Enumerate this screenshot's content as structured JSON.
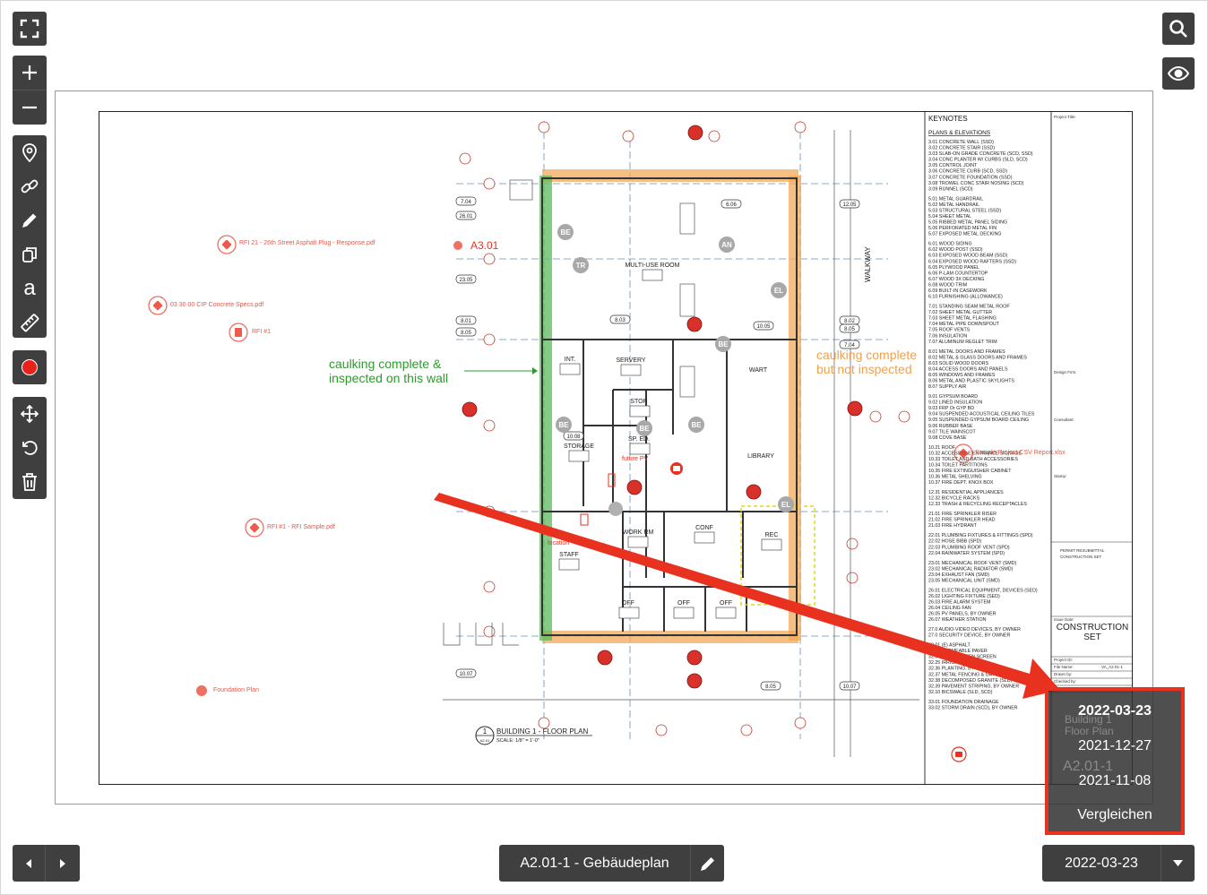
{
  "toolbar": {
    "fullscreen_icon": "fullscreen-icon",
    "zoom_in_icon": "plus-icon",
    "zoom_out_icon": "minus-icon",
    "tools": [
      "pin-icon",
      "link-icon",
      "pen-icon",
      "copy-icon",
      "text-tool",
      "ruler-icon"
    ],
    "text_tool_label": "a",
    "record_color": "#e8211b",
    "edit_tools": [
      "move-icon",
      "undo-icon",
      "trash-icon"
    ]
  },
  "top_right": {
    "search_icon": "search-icon",
    "visibility_icon": "eye-icon"
  },
  "annotations": {
    "green_note": [
      "caulking complete &",
      "inspected on this wall"
    ],
    "orange_note": [
      "caulking complete",
      "but not inspected"
    ],
    "red_label": "A3.01",
    "rfi_21": "RFI 21 - 26th Street Asphalt Plug - Response.pdf",
    "specs": "03 30 00 CIP Concrete Specs.pdf",
    "rfi_1": "RFI #1",
    "rfi_sample": "RFI #1 - RFI Sample.pdf",
    "foundation": "Foundation Plan",
    "csv_report": "Sample Project CSV Report.xlsx",
    "printer": "Printer location",
    "future_pv": "future PV",
    "colors": {
      "green": "#2e9a2e",
      "orange": "#f0a050",
      "red": "#e8321f"
    }
  },
  "drawing": {
    "keynotes_title": "KEYNOTES",
    "plans_elevations": "PLANS & ELEVATIONS",
    "keynote_lines": [
      "3.01 CONCRETE WALL (SSD)",
      "3.02 CONCRETE STAIR (SSD)",
      "3.03 SLAB-ON GRADE CONCRETE (SCD, SSD)",
      "3.04 CONC PLANTER W/ CURBS (SLD, SCD)",
      "3.05 CONTROL JOINT",
      "3.06 CONCRETE CURB (SCD, SSD)",
      "3.07 CONCRETE FOUNDATION (SSD)",
      "3.08 TROWEL CONC STAIR NOSING (SCD)",
      "3.09 RUNNEL (SCD)",
      "",
      "5.01 METAL GUARDRAIL",
      "5.02 METAL HANDRAIL",
      "5.03 STRUCTURAL STEEL (SSD)",
      "5.04 SHEET METAL",
      "5.05 RIBBED METAL PANEL SIDING",
      "5.06 PERFORATED METAL FIN",
      "5.07 EXPOSED METAL DECKING",
      "",
      "6.01 WOOD SIDING",
      "6.02 WOOD POST (SSD)",
      "6.03 EXPOSED WOOD BEAM (SSD)",
      "6.04 EXPOSED WOOD RAFTERS (SSD)",
      "6.05 PLYWOOD PANEL",
      "6.06 P-LAM COUNTERTOP",
      "6.07 WOOD 3X DECKING",
      "6.08 WOOD TRIM",
      "6.09 BUILT-IN CASEWORK",
      "6.10 FURNISHING (ALLOWANCE)",
      "",
      "7.01 STANDING SEAM METAL ROOF",
      "7.02 SHEET METAL GUTTER",
      "7.03 SHEET METAL FLASHING",
      "7.04 METAL PIPE DOWNSPOUT",
      "7.05 ROOF VENTS",
      "7.06 INSULATION",
      "7.07 ALUMINUM REGLET TRIM",
      "",
      "8.01 METAL DOORS AND FRAMES",
      "8.02 METAL & GLASS DOORS AND FRAMES",
      "8.03 SOLID WOOD DOORS",
      "8.04 ACCESS DOORS AND PANELS",
      "8.05 WINDOWS AND FRAMES",
      "8.06 METAL AND PLASTIC SKYLIGHTS",
      "8.07 SUPPLY AIR",
      "",
      "9.01 GYPSUM BOARD",
      "9.02 LINED INSULATION",
      "9.03 FRP Or GYP BD",
      "9.04 SUSPENDED ACOUSTICAL CEILING TILES",
      "9.05 SUSPENDED GYPSUM BOARD CEILING",
      "9.06 RUBBER BASE",
      "9.07 TILE WAINSCOT",
      "9.08 COVE BASE",
      "",
      "10.21 ROOF",
      "10.32 ACCESSIBLE ENTRANCE SIGNAGE",
      "10.33 TOILET AND BATH ACCESSORIES",
      "10.34 TOILET PARTITIONS",
      "10.35 FIRE EXTINGUISHER CABINET",
      "10.36 METAL SHELVING",
      "10.37 FIRE DEPT. KNOX BOX",
      "",
      "12.31 RESIDENTIAL APPLIANCES",
      "12.32 BICYCLE RACKS",
      "12.33 TRASH & RECYCLING RECEPTACLES",
      "",
      "21.01 FIRE SPRINKLER RISER",
      "21.02 FIRE SPRINKLER HEAD",
      "21.03 FIRE HYDRANT",
      "",
      "22.01 PLUMBING FIXTURES & FITTINGS (SPD)",
      "22.02 HOSE BIBB (SPD)",
      "22.03 PLUMBING ROOF VENT (SPD)",
      "22.04 RAINWATER SYSTEM (SPD)",
      "",
      "23.01 MECHANICAL ROOF VENT (SMD)",
      "23.02 MECHANICAL RADIATOR (SMD)",
      "23.04 EXHAUST FAN (SMD)",
      "23.05 MECHANICAL UNIT (SMD)",
      "",
      "26.01 ELECTRICAL EQUIPMENT, DEVICES (SED)",
      "26.02 LIGHTING FIXTURE (SED)",
      "26.03 FIRE ALARM SYSTEM",
      "26.04 CEILING FAN",
      "26.05 PV PANELS, BY OWNER",
      "26.07 WEATHER STATION",
      "",
      "27.0 AUDIO-VIDEO DEVICES, BY OWNER",
      "27.0 SECURITY DEVICE, BY OWNER",
      "",
      "32.01 (E) ASPHALT",
      "32.02 PERMEABLE PAVER",
      "32.04 METAL GREEN SCREEN",
      "32.25 IRRIGATION (SLD)",
      "32.36 PLANTING, BY OWNER",
      "32.37 METAL FENCING & GATE",
      "32.38 DECOMPOSED GRANITE (SLD)",
      "32.39 PAVEMENT STRIPING, BY OWNER",
      "32.10 BICSWALE (SLD, SCD)",
      "",
      "33.01 FOUNDATION DRAINAGE",
      "33.02 STORM DRAIN (SCD), BY OWNER"
    ],
    "plan_title": "BUILDING 1 - FLOOR PLAN",
    "plan_scale": "SCALE: 1/8\" = 1'-0\"",
    "plan_number": "1",
    "plan_sheet": "A2.01",
    "walkway": "WALKWAY",
    "rooms": [
      "MULTI-USE ROOM",
      "SERVERY",
      "INT.",
      "STOR",
      "STORAGE",
      "SP. ED.",
      "STAFF",
      "WORK RM",
      "CONF",
      "REC",
      "LIBRARY",
      "OFF",
      "OFF",
      "OFF",
      "WART"
    ],
    "tags": [
      "BE",
      "BE",
      "BE",
      "BE",
      "BE",
      "AN",
      "TR",
      "EL",
      "EL"
    ],
    "construction_set": [
      "CONSTRUCTION",
      "SET"
    ],
    "titleblock_labels": [
      "Project Title:",
      "Design Firm:",
      "Consultant:",
      "Stamp:",
      "Issue Date:",
      "Project ID:",
      "File Name:",
      "Drawn by:",
      "Checked by:"
    ],
    "file_name_value": "VA_A2.01-1",
    "revisions": [
      "PERMIT RESUBMITTAL",
      "CONSTRUCTION SET"
    ],
    "sheet_title_faded": [
      "Building 1",
      "Floor Plan"
    ],
    "sheet_number_faded": "A2.01-1"
  },
  "date_menu": {
    "options": [
      "2022-03-23",
      "2021-12-27",
      "2021-11-08"
    ],
    "compare_label": "Vergleichen"
  },
  "bottom": {
    "prev_icon": "prev-icon",
    "next_icon": "next-icon",
    "sheet_label": "A2.01-1 - Gebäudeplan",
    "edit_icon": "pencil-icon",
    "date_value": "2022-03-23",
    "caret_icon": "caret-down-icon"
  }
}
